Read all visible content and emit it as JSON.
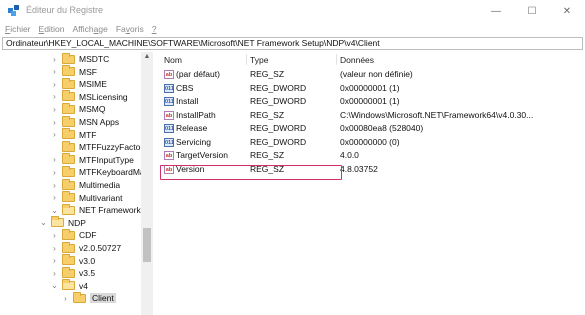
{
  "window": {
    "title": "Éditeur du Registre",
    "controls": {
      "minimize": "—",
      "maximize": "☐",
      "close": "✕"
    }
  },
  "menu": [
    {
      "label": "Fichier",
      "accel": "F",
      "rest": "ichier"
    },
    {
      "label": "Edition",
      "accel": "E",
      "rest": "dition"
    },
    {
      "label": "Affichage",
      "accel": "",
      "rest": "Affich",
      "accel2": "a",
      "rest2": "ge"
    },
    {
      "label": "Favoris",
      "accel": "",
      "rest": "Fa",
      "accel2": "v",
      "rest2": "oris"
    },
    {
      "label": "?",
      "accel": "?",
      "rest": ""
    }
  ],
  "address": "Ordinateur\\HKEY_LOCAL_MACHINE\\SOFTWARE\\Microsoft\\NET Framework Setup\\NDP\\v4\\Client",
  "tree": [
    {
      "label": "MSDTC",
      "chev": ">",
      "indent": 0
    },
    {
      "label": "MSF",
      "chev": ">",
      "indent": 0
    },
    {
      "label": "MSIME",
      "chev": ">",
      "indent": 0
    },
    {
      "label": "MSLicensing",
      "chev": ">",
      "indent": 0
    },
    {
      "label": "MSMQ",
      "chev": ">",
      "indent": 0
    },
    {
      "label": "MSN Apps",
      "chev": ">",
      "indent": 0
    },
    {
      "label": "MTF",
      "chev": ">",
      "indent": 0
    },
    {
      "label": "MTFFuzzyFactors",
      "chev": "",
      "indent": 0
    },
    {
      "label": "MTFInputType",
      "chev": ">",
      "indent": 0
    },
    {
      "label": "MTFKeyboardMa",
      "chev": ">",
      "indent": 0
    },
    {
      "label": "Multimedia",
      "chev": ">",
      "indent": 0
    },
    {
      "label": "Multivariant",
      "chev": ">",
      "indent": 0
    },
    {
      "label": "NET Framework S",
      "chev": "v",
      "indent": 0
    },
    {
      "label": "NDP",
      "chev": "v",
      "indent": 1
    },
    {
      "label": "CDF",
      "chev": ">",
      "indent": 2
    },
    {
      "label": "v2.0.50727",
      "chev": ">",
      "indent": 2
    },
    {
      "label": "v3.0",
      "chev": ">",
      "indent": 2
    },
    {
      "label": "v3.5",
      "chev": ">",
      "indent": 2
    },
    {
      "label": "v4",
      "chev": "v",
      "indent": 2
    },
    {
      "label": "Client",
      "chev": ">",
      "indent": 3,
      "selected": true
    }
  ],
  "columns": {
    "name": "Nom",
    "type": "Type",
    "data": "Données"
  },
  "values": [
    {
      "icon": "ab",
      "kind": "sz",
      "name": "(par défaut)",
      "type": "REG_SZ",
      "data": "(valeur non définie)"
    },
    {
      "icon": "011",
      "kind": "dw",
      "name": "CBS",
      "type": "REG_DWORD",
      "data": "0x00000001 (1)"
    },
    {
      "icon": "011",
      "kind": "dw",
      "name": "Install",
      "type": "REG_DWORD",
      "data": "0x00000001 (1)"
    },
    {
      "icon": "ab",
      "kind": "sz",
      "name": "InstallPath",
      "type": "REG_SZ",
      "data": "C:\\Windows\\Microsoft.NET\\Framework64\\v4.0.30..."
    },
    {
      "icon": "011",
      "kind": "dw",
      "name": "Release",
      "type": "REG_DWORD",
      "data": "0x00080ea8 (528040)"
    },
    {
      "icon": "011",
      "kind": "dw",
      "name": "Servicing",
      "type": "REG_DWORD",
      "data": "0x00000000 (0)"
    },
    {
      "icon": "ab",
      "kind": "sz",
      "name": "TargetVersion",
      "type": "REG_SZ",
      "data": "4.0.0"
    },
    {
      "icon": "ab",
      "kind": "sz",
      "name": "Version",
      "type": "REG_SZ",
      "data": "4.8.03752",
      "highlighted": true
    }
  ],
  "colors": {
    "highlight": "#d32f6b",
    "folder": "#f6cf6a"
  }
}
